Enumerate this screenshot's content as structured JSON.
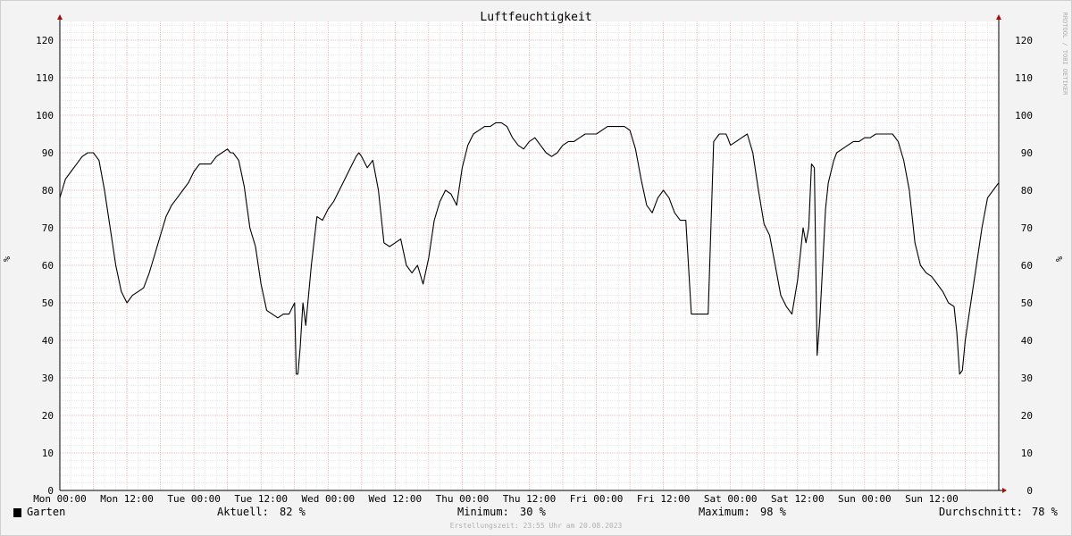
{
  "chart_data": {
    "type": "line",
    "title": "Luftfeuchtigkeit",
    "ylabel": "%",
    "ylim": [
      0,
      125
    ],
    "yticks": [
      0,
      10,
      20,
      30,
      40,
      50,
      60,
      70,
      80,
      90,
      100,
      110,
      120
    ],
    "xlim": [
      0,
      168
    ],
    "xticks": [
      {
        "x": 0,
        "label": "Mon 00:00"
      },
      {
        "x": 12,
        "label": "Mon 12:00"
      },
      {
        "x": 24,
        "label": "Tue 00:00"
      },
      {
        "x": 36,
        "label": "Tue 12:00"
      },
      {
        "x": 48,
        "label": "Wed 00:00"
      },
      {
        "x": 60,
        "label": "Wed 12:00"
      },
      {
        "x": 72,
        "label": "Thu 00:00"
      },
      {
        "x": 84,
        "label": "Thu 12:00"
      },
      {
        "x": 96,
        "label": "Fri 00:00"
      },
      {
        "x": 108,
        "label": "Fri 12:00"
      },
      {
        "x": 120,
        "label": "Sat 00:00"
      },
      {
        "x": 132,
        "label": "Sat 12:00"
      },
      {
        "x": 144,
        "label": "Sun 00:00"
      },
      {
        "x": 156,
        "label": "Sun 12:00"
      }
    ],
    "grid": true,
    "series": [
      {
        "name": "Garten",
        "color": "#000000",
        "x": [
          0,
          1,
          2,
          3,
          4,
          5,
          6,
          7,
          8,
          9,
          10,
          11,
          12,
          13,
          14,
          15,
          16,
          17,
          18,
          19,
          20,
          21,
          22,
          23,
          24,
          25,
          26,
          27,
          28,
          29,
          30,
          30.5,
          31,
          32,
          33,
          34,
          35,
          36,
          37,
          38,
          39,
          40,
          41,
          42,
          42.3,
          42.6,
          43,
          43.5,
          44,
          45,
          46,
          47,
          48,
          49,
          50,
          51,
          52,
          53,
          53.5,
          54,
          55,
          56,
          57,
          58,
          59,
          60,
          61,
          62,
          63,
          64,
          65,
          66,
          67,
          68,
          69,
          70,
          71,
          72,
          73,
          74,
          75,
          76,
          77,
          78,
          79,
          80,
          81,
          82,
          83,
          84,
          85,
          86,
          87,
          88,
          89,
          90,
          91,
          92,
          93,
          94,
          95,
          96,
          97,
          98,
          99,
          100,
          101,
          102,
          103,
          104,
          105,
          106,
          107,
          108,
          109,
          109.5,
          110,
          111,
          112,
          113,
          114,
          115,
          115.5,
          116,
          117,
          118,
          119,
          119.2,
          119.5,
          120,
          121,
          122,
          123,
          124,
          125,
          126,
          127,
          128,
          129,
          130,
          131,
          132,
          133,
          133.5,
          134,
          134.5,
          135,
          135.5,
          136,
          136.5,
          137,
          137.5,
          138,
          138.5,
          139,
          140,
          141,
          142,
          143,
          144,
          145,
          146,
          147,
          148,
          149,
          150,
          151,
          152,
          153,
          154,
          155,
          156,
          157,
          158,
          159,
          160,
          160.5,
          161,
          161.5,
          162,
          163,
          164,
          165,
          166,
          167,
          168
        ],
        "y": [
          78,
          83,
          85,
          87,
          89,
          90,
          90,
          88,
          80,
          70,
          60,
          53,
          50,
          52,
          53,
          54,
          58,
          63,
          68,
          73,
          76,
          78,
          80,
          82,
          85,
          87,
          87,
          87,
          89,
          90,
          91,
          90,
          90,
          88,
          81,
          70,
          65,
          55,
          48,
          47,
          46,
          47,
          47,
          50,
          31,
          31,
          38,
          50,
          44,
          60,
          73,
          72,
          75,
          77,
          80,
          83,
          86,
          89,
          90,
          89,
          86,
          88,
          80,
          66,
          65,
          66,
          67,
          60,
          58,
          60,
          55,
          62,
          72,
          77,
          80,
          79,
          76,
          86,
          92,
          95,
          96,
          97,
          97,
          98,
          98,
          97,
          94,
          92,
          91,
          93,
          94,
          92,
          90,
          89,
          90,
          92,
          93,
          93,
          94,
          95,
          95,
          95,
          96,
          97,
          97,
          97,
          97,
          96,
          91,
          83,
          76,
          74,
          78,
          80,
          78,
          76,
          74,
          72,
          72,
          47,
          47,
          47,
          47,
          47,
          93,
          95,
          95,
          95,
          94,
          92,
          93,
          94,
          95,
          90,
          80,
          71,
          68,
          60,
          52,
          49,
          47,
          56,
          70,
          66,
          70,
          87,
          86,
          36,
          46,
          60,
          75,
          82,
          85,
          88,
          90,
          91,
          92,
          93,
          93,
          94,
          94,
          95,
          95,
          95,
          95,
          93,
          88,
          80,
          66,
          60,
          58,
          57,
          55,
          53,
          50,
          49,
          42,
          31,
          32,
          40,
          50,
          60,
          70,
          78,
          80,
          82
        ]
      }
    ]
  },
  "labels": {
    "watermark": "RRDTOOL / TOBI OETIKER",
    "legend_name": "Garten",
    "current_label": "Aktuell:",
    "current_value": "82 %",
    "min_label": "Minimum:",
    "min_value": "30 %",
    "max_label": "Maximum:",
    "max_value": "98 %",
    "avg_label": "Durchschnitt:",
    "avg_value": "78 %",
    "created": "Erstellungszeit: 23:55 Uhr am 20.08.2023"
  }
}
